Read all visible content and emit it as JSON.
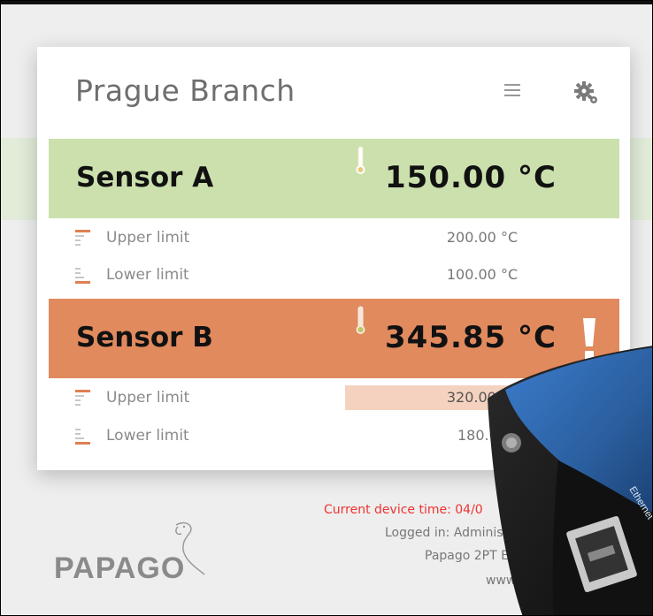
{
  "panel": {
    "title": "Prague Branch",
    "menu_icon": "hamburger-menu-icon",
    "settings_icon": "gear-icon"
  },
  "sensors": [
    {
      "name": "Sensor A",
      "value": "150.00 °C",
      "status_color": "#cbe0ad",
      "alert": false,
      "upper_label": "Upper limit",
      "upper_value": "200.00 °C",
      "lower_label": "Lower limit",
      "lower_value": "100.00 °C"
    },
    {
      "name": "Sensor B",
      "value": "345.85 °C",
      "status_color": "#e08a5e",
      "alert": true,
      "upper_label": "Upper limit",
      "upper_value": "320.00 °C",
      "lower_label": "Lower limit",
      "lower_value": "180.00"
    }
  ],
  "footer": {
    "device_time": "Current device time: 04/0",
    "logged_in": "Logged in: Adminis",
    "device_model": "Papago 2PT ETH",
    "website": "www.pap"
  },
  "logo": {
    "text": "PAPAGO"
  },
  "device_photo": {
    "port_label": "Ethernet"
  },
  "colors": {
    "accent_orange": "#e07f52",
    "ok_green": "#cbe0ad",
    "alert_orange": "#e08a5e",
    "device_blue": "#2b63a8",
    "time_red": "#ee3333"
  }
}
